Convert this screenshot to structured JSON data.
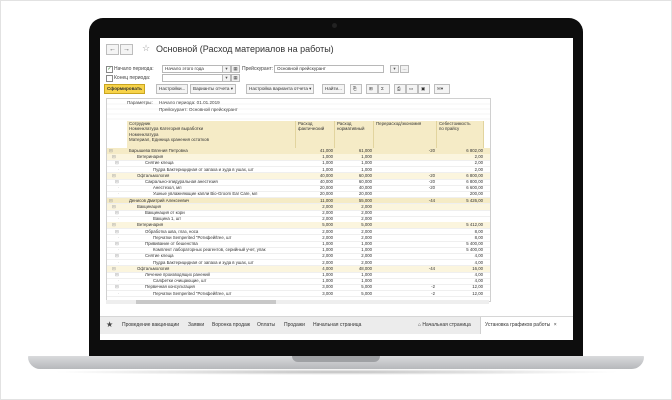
{
  "window": {
    "title": "Основной (Расход материалов на работы)",
    "back": "←",
    "forward": "→"
  },
  "filters": {
    "period_start_label": "Начало периода:",
    "period_start_value": "Начало этого года",
    "period_end_label": "Конец периода:",
    "pricelist_label": "Прейскурант:",
    "pricelist_value": "Основной прейскурант"
  },
  "toolbar": {
    "generate": "Сформировать",
    "settings": "Настройки...",
    "variants": "Варианты отчета ▾",
    "variant_setup": "Настройка варианта отчета ▾",
    "find": "Найти...",
    "sum_symbol": "Σ"
  },
  "report": {
    "params_label": "Параметры:",
    "param_period": "Начало периода: 01.01.2019",
    "param_pricelist": "Прейскурант: Основной прейскурант",
    "headers": {
      "name": [
        "Сотрудник",
        "Номенклатура Категория выработки",
        "Номенклатура",
        "Материал, Единица хранения остатков"
      ],
      "fact": [
        "Расход",
        "фактический"
      ],
      "norm": [
        "Расход",
        "нормативный"
      ],
      "diff": [
        "Перерасход/экономия"
      ],
      "cost": [
        "Себестоимость",
        "по прайсу"
      ]
    },
    "rows": [
      {
        "level": 0,
        "name": "Барышева Евгения Петровна",
        "fact": "41,000",
        "norm": "61,000",
        "diff": "-20",
        "cost": "6 802,00"
      },
      {
        "level": 1,
        "name": "Ветеринария",
        "fact": "1,000",
        "norm": "1,000",
        "diff": "",
        "cost": "2,00"
      },
      {
        "level": 2,
        "name": "Снятие клеща",
        "fact": "1,000",
        "norm": "1,000",
        "diff": "",
        "cost": "2,00"
      },
      {
        "level": 3,
        "name": "Пудра Бактерицидная от запаха и зуда в ушах, шт",
        "fact": "1,000",
        "norm": "1,000",
        "diff": "",
        "cost": "2,00"
      },
      {
        "level": 1,
        "name": "Офтальмология",
        "fact": "40,000",
        "norm": "60,000",
        "diff": "-20",
        "cost": "6 800,00"
      },
      {
        "level": 2,
        "name": "Сакрально-эпидуральная анестезия",
        "fact": "40,000",
        "norm": "60,000",
        "diff": "-20",
        "cost": "6 800,00"
      },
      {
        "level": 3,
        "name": "Анестезол, мл",
        "fact": "20,000",
        "norm": "40,000",
        "diff": "-20",
        "cost": "6 600,00"
      },
      {
        "level": 3,
        "name": "Ушные увлажняющие капли Bio-Groom Ear Care, мл",
        "fact": "20,000",
        "norm": "20,000",
        "diff": "",
        "cost": "200,00"
      },
      {
        "level": 0,
        "name": "Денисов Дмитрий Алексеевич",
        "fact": "11,000",
        "norm": "55,000",
        "diff": "-44",
        "cost": "5 426,00"
      },
      {
        "level": 1,
        "name": "Вакцинация",
        "fact": "2,000",
        "norm": "2,000",
        "diff": "",
        "cost": ""
      },
      {
        "level": 2,
        "name": "Вакцинация от кори",
        "fact": "2,000",
        "norm": "2,000",
        "diff": "",
        "cost": ""
      },
      {
        "level": 3,
        "name": "Вакцина 1, шт",
        "fact": "2,000",
        "norm": "2,000",
        "diff": "",
        "cost": ""
      },
      {
        "level": 1,
        "name": "Ветеринария",
        "fact": "5,000",
        "norm": "5,000",
        "diff": "",
        "cost": "5 412,00"
      },
      {
        "level": 2,
        "name": "Обработка шва, глаз, носа",
        "fact": "2,000",
        "norm": "2,000",
        "diff": "",
        "cost": "8,00"
      },
      {
        "level": 3,
        "name": "Перчатки Semperited \"Ротифей/tree, шт",
        "fact": "2,000",
        "norm": "2,000",
        "diff": "",
        "cost": "8,00"
      },
      {
        "level": 2,
        "name": "Прививание от бешенства",
        "fact": "1,000",
        "norm": "1,000",
        "diff": "",
        "cost": "5 400,00"
      },
      {
        "level": 3,
        "name": "Комплект лабораторных реагентов, серийный учет, упак",
        "fact": "1,000",
        "norm": "1,000",
        "diff": "",
        "cost": "5 400,00"
      },
      {
        "level": 2,
        "name": "Снятие клеща",
        "fact": "2,000",
        "norm": "2,000",
        "diff": "",
        "cost": "4,00"
      },
      {
        "level": 3,
        "name": "Пудра Бактерицидная от запаха и зуда в ушах, шт",
        "fact": "2,000",
        "norm": "2,000",
        "diff": "",
        "cost": "4,00"
      },
      {
        "level": 1,
        "name": "Офтальмология",
        "fact": "4,000",
        "norm": "48,000",
        "diff": "-44",
        "cost": "16,00"
      },
      {
        "level": 2,
        "name": "Лечение производящих ранений",
        "fact": "1,000",
        "norm": "1,000",
        "diff": "",
        "cost": "4,00"
      },
      {
        "level": 3,
        "name": "Салфетки очищающие, шт",
        "fact": "1,000",
        "norm": "1,000",
        "diff": "",
        "cost": "4,00"
      },
      {
        "level": 2,
        "name": "Первичная консультация",
        "fact": "3,000",
        "norm": "5,000",
        "diff": "-2",
        "cost": "12,00"
      },
      {
        "level": 3,
        "name": "Перчатки Semperited \"Ротифей/tree, шт",
        "fact": "3,000",
        "norm": "5,000",
        "diff": "-2",
        "cost": "12,00"
      }
    ]
  },
  "taskbar": {
    "links": [
      "Проведение вакцинации",
      "Заявки",
      "Воронка продаж",
      "Оплаты",
      "Продажи",
      "Начальная страница"
    ],
    "tab_home": "Начальная страница",
    "tab_active": "Установка графиков работы",
    "close": "×"
  }
}
